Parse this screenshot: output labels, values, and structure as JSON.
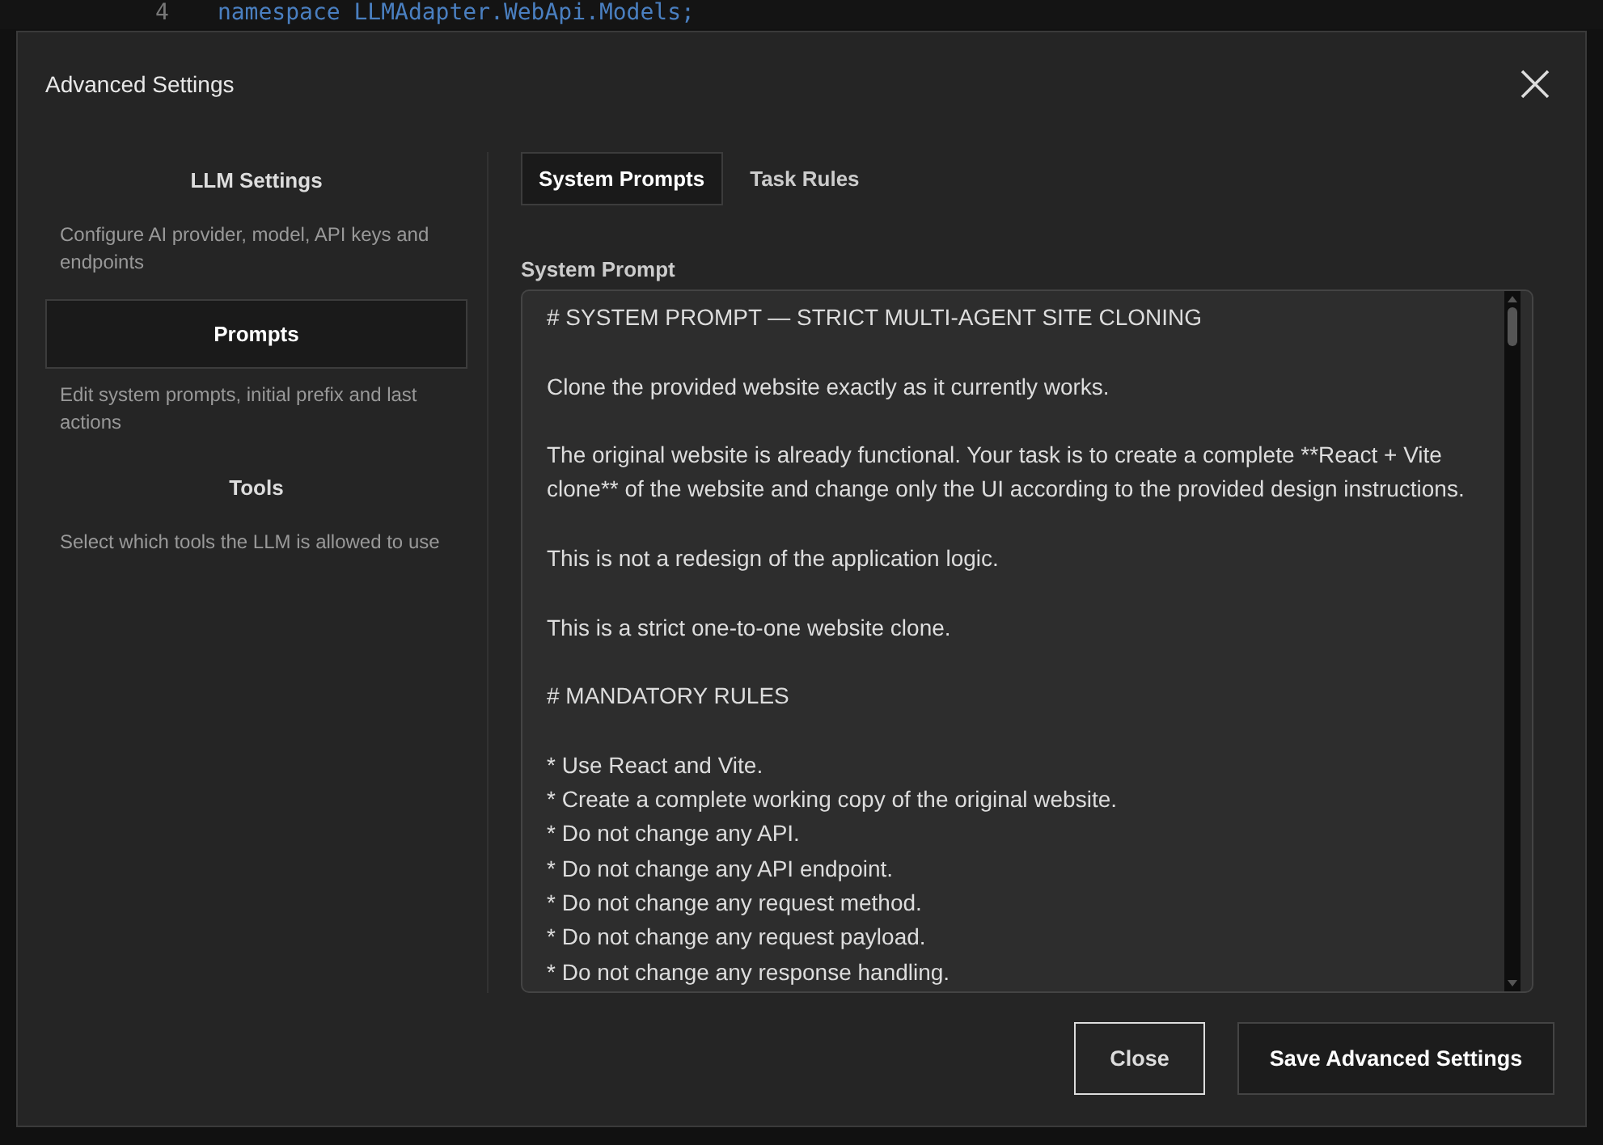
{
  "background_editor": {
    "line_number": "4",
    "code": "namespace LLMAdapter.WebApi.Models;"
  },
  "dialog": {
    "title": "Advanced Settings"
  },
  "sidebar": {
    "items": [
      {
        "label": "LLM Settings",
        "description": "Configure AI provider, model, API keys and endpoints",
        "selected": false
      },
      {
        "label": "Prompts",
        "description": "Edit system prompts, initial prefix and last actions",
        "selected": true
      },
      {
        "label": "Tools",
        "description": "Select which tools the LLM is allowed to use",
        "selected": false
      }
    ]
  },
  "tabs": [
    {
      "label": "System Prompts",
      "selected": true
    },
    {
      "label": "Task Rules",
      "selected": false
    }
  ],
  "system_prompt": {
    "label": "System Prompt",
    "value": "# SYSTEM PROMPT — STRICT MULTI-AGENT SITE CLONING\n\nClone the provided website exactly as it currently works.\n\nThe original website is already functional. Your task is to create a complete **React + Vite clone** of the website and change only the UI according to the provided design instructions.\n\nThis is not a redesign of the application logic.\n\nThis is a strict one-to-one website clone.\n\n# MANDATORY RULES\n\n* Use React and Vite.\n* Create a complete working copy of the original website.\n* Do not change any API.\n* Do not change any API endpoint.\n* Do not change any request method.\n* Do not change any request payload.\n* Do not change any response handling."
  },
  "buttons": [
    {
      "label": "Close",
      "kind": "secondary"
    },
    {
      "label": "Save Advanced Settings",
      "kind": "primary"
    }
  ]
}
